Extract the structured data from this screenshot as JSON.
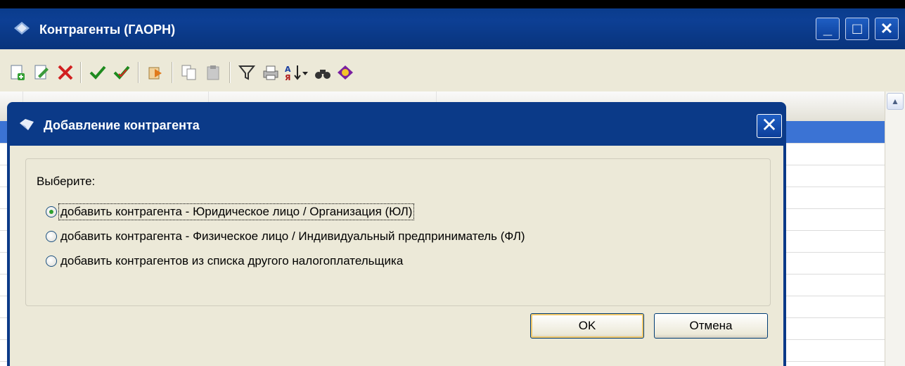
{
  "main_window": {
    "title": "Контрагенты (ГАОРН)",
    "controls": {
      "minimize": "_",
      "maximize": "□",
      "close": "✕"
    }
  },
  "toolbar": {
    "icons": [
      "add-record-icon",
      "edit-record-icon",
      "delete-icon",
      "check-icon",
      "check-all-icon",
      "copy-to-icon",
      "copy-icon",
      "paste-icon",
      "filter-icon",
      "print-icon",
      "sort-icon",
      "dropdown-arrow-icon",
      "find-icon",
      "help-book-icon"
    ]
  },
  "grid": {
    "selected_row_index": 0
  },
  "dialog": {
    "title": "Добавление контрагента",
    "close": "✕",
    "choose_label": "Выберите:",
    "options": [
      {
        "label": "добавить контрагента - Юридическое лицо / Организация (ЮЛ)",
        "checked": true
      },
      {
        "label": "добавить контрагента - Физическое лицо / Индивидуальный предприниматель (ФЛ)",
        "checked": false
      },
      {
        "label": "добавить контрагентов из списка другого налогоплательщика",
        "checked": false
      }
    ],
    "ok_label": "OK",
    "cancel_label": "Отмена"
  },
  "colors": {
    "titlebar": "#0b3a88",
    "window_bg": "#ece9d8",
    "selection": "#3b73d4"
  }
}
